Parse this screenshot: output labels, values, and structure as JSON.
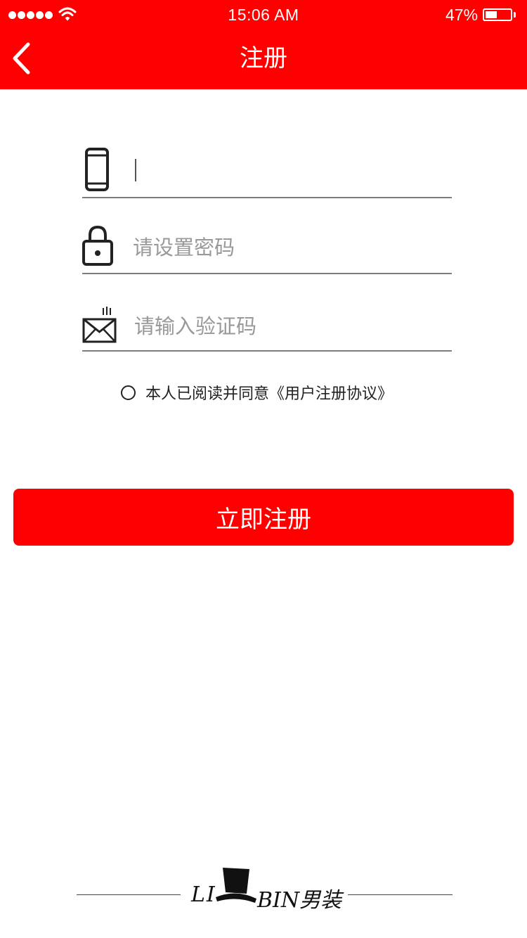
{
  "status_bar": {
    "time": "15:06 AM",
    "battery_percent": "47%",
    "battery_level": 0.47
  },
  "header": {
    "title": "注册",
    "background": "#ff0000"
  },
  "form": {
    "phone": {
      "icon": "phone-icon",
      "value": "",
      "placeholder": ""
    },
    "password": {
      "icon": "lock-icon",
      "value": "",
      "placeholder": "请设置密码"
    },
    "code": {
      "icon": "envelope-icon",
      "value": "",
      "placeholder": "请输入验证码"
    }
  },
  "agreement": {
    "checked": false,
    "text": "本人已阅读并同意《用户注册协议》"
  },
  "submit_label": "立即注册",
  "footer": {
    "brand_left": "LI",
    "brand_right": "BIN男装",
    "logo_icon": "top-hat-icon"
  }
}
